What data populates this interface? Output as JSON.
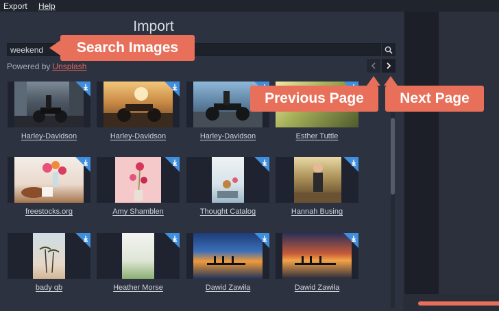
{
  "menu": {
    "export": "Export",
    "help": "Help"
  },
  "dialog": {
    "title": "Import"
  },
  "search": {
    "value": "weekend",
    "placeholder": ""
  },
  "powered": {
    "prefix": "Powered by",
    "link": "Unsplash"
  },
  "callouts": {
    "search": "Search Images",
    "previous": "Previous Page",
    "next": "Next Page"
  },
  "images": [
    {
      "caption": "Harley-Davidson",
      "scene": "motorcycle-city"
    },
    {
      "caption": "Harley-Davidson",
      "scene": "motorcycle-sunset"
    },
    {
      "caption": "Harley-Davidson",
      "scene": "motorcycle-road"
    },
    {
      "caption": "Esther Tuttle",
      "scene": "forest-light"
    },
    {
      "caption": "freestocks.org",
      "scene": "flowers-breakfast"
    },
    {
      "caption": "Amy Shamblen",
      "scene": "pink-flowers"
    },
    {
      "caption": "Thought Catalog",
      "scene": "cafe-table"
    },
    {
      "caption": "Hannah Busing",
      "scene": "woman-bridge"
    },
    {
      "caption": "bady qb",
      "scene": "palm-trees"
    },
    {
      "caption": "Heather Morse",
      "scene": "beach-grass"
    },
    {
      "caption": "Dawid Zawiła",
      "scene": "lake-sunset-people"
    },
    {
      "caption": "Dawid Zawiła",
      "scene": "lake-sunset-pier"
    }
  ],
  "colors": {
    "accent": "#e8705a",
    "download_badge": "#3f8fde",
    "link": "#e0655e"
  }
}
